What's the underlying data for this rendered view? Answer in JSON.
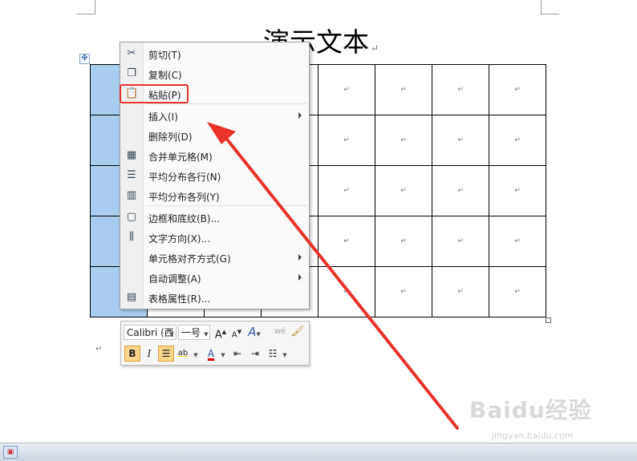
{
  "document": {
    "title": "演示文本",
    "para_mark": "↵"
  },
  "table": {
    "rows": 5,
    "cols": 8,
    "cell_mark": "↵"
  },
  "context_menu": {
    "items": [
      {
        "label": "剪切(T)",
        "icon": "scissors-icon",
        "glyph": "✂"
      },
      {
        "label": "复制(C)",
        "icon": "copy-icon",
        "glyph": "❐"
      },
      {
        "label": "粘贴(P)",
        "icon": "paste-icon",
        "glyph": "📋"
      },
      {
        "label": "插入(I)",
        "icon": "",
        "glyph": ""
      },
      {
        "label": "删除列(D)",
        "icon": "",
        "glyph": ""
      },
      {
        "label": "合并单元格(M)",
        "icon": "merge-cells-icon",
        "glyph": "▦"
      },
      {
        "label": "平均分布各行(N)",
        "icon": "distribute-rows-icon",
        "glyph": "☰"
      },
      {
        "label": "平均分布各列(Y)",
        "icon": "distribute-columns-icon",
        "glyph": "▥"
      },
      {
        "label": "边框和底纹(B)...",
        "icon": "borders-icon",
        "glyph": "▢"
      },
      {
        "label": "文字方向(X)...",
        "icon": "text-direction-icon",
        "glyph": "⫼"
      },
      {
        "label": "单元格对齐方式(G)",
        "icon": "",
        "glyph": ""
      },
      {
        "label": "自动调整(A)",
        "icon": "",
        "glyph": ""
      },
      {
        "label": "表格属性(R)...",
        "icon": "table-properties-icon",
        "glyph": "▤"
      }
    ]
  },
  "mini_toolbar": {
    "font_name": "Calibri (西",
    "font_size": "一号",
    "grow_font": "A",
    "shrink_font": "A",
    "styles": "A",
    "format_painter": "🖌",
    "bold": "B",
    "italic": "I",
    "highlight": "ab",
    "font_color": "A"
  },
  "colors": {
    "selection": "#a9cdee",
    "highlight_box": "#e8322a",
    "arrow": "#e8322a"
  },
  "watermark": {
    "brand": "Baidu经验",
    "url": "jingyan.baidu.com"
  }
}
